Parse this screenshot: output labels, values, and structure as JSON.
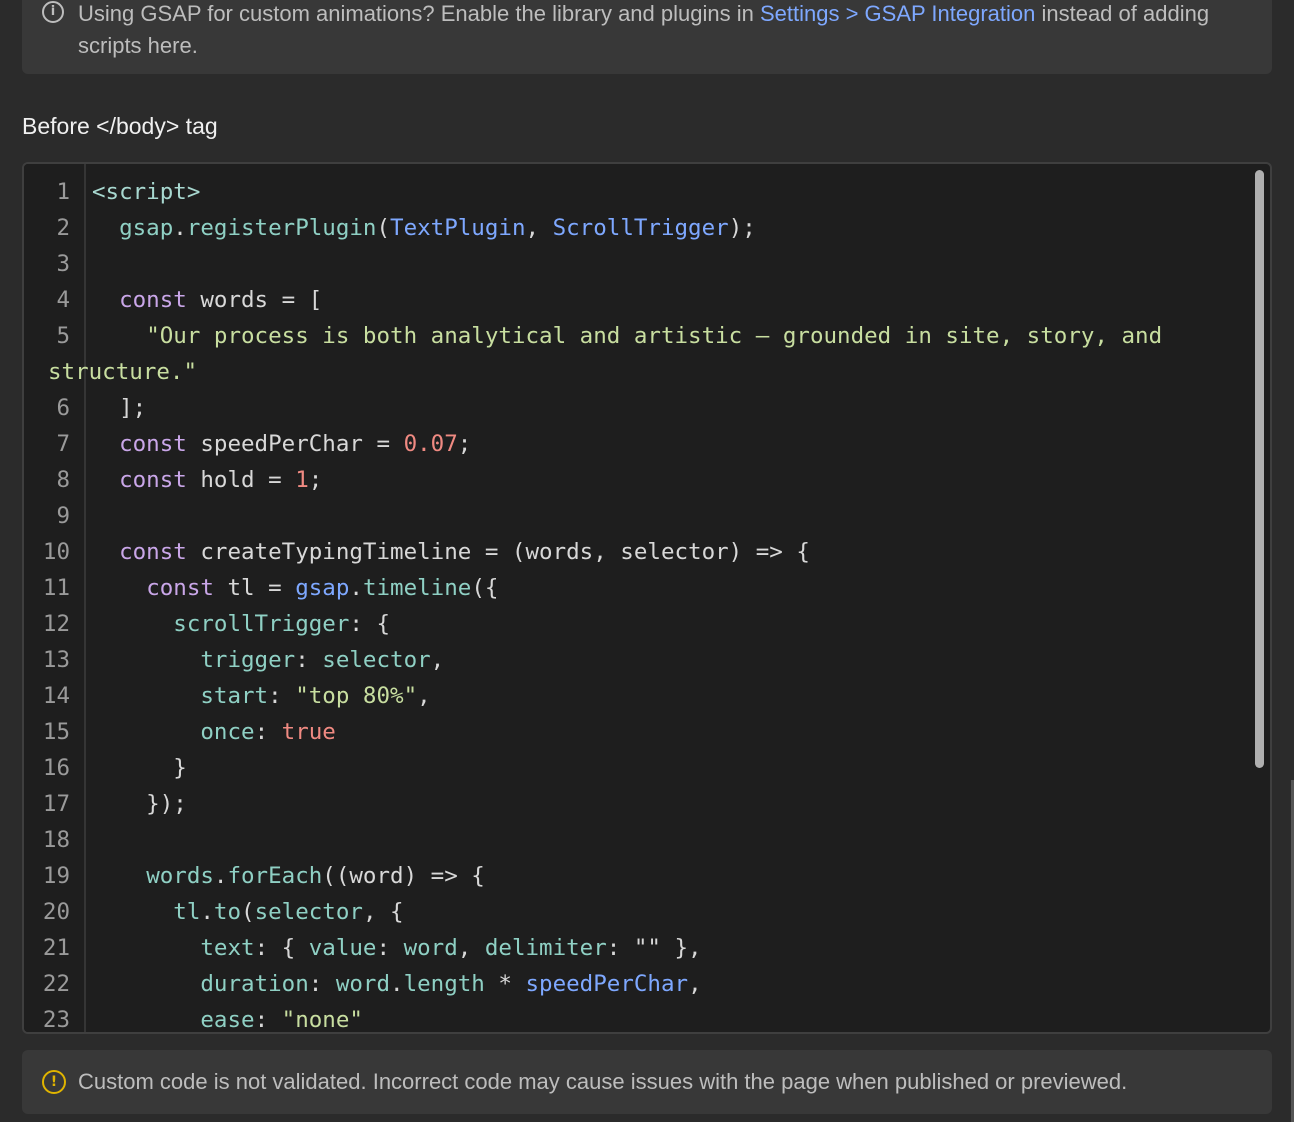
{
  "top_notice": {
    "icon": "info-icon",
    "icon_glyph": "i",
    "text_before": "Using GSAP for custom animations? Enable the library and plugins in ",
    "link_text": "Settings > GSAP Integration",
    "text_after": " instead of adding scripts here."
  },
  "section": {
    "label": "Before </body> tag"
  },
  "editor": {
    "lines": [
      {
        "n": "1"
      },
      {
        "n": "2"
      },
      {
        "n": "3"
      },
      {
        "n": "4"
      },
      {
        "n": "5"
      },
      {
        "n": ""
      },
      {
        "n": "6"
      },
      {
        "n": "7"
      },
      {
        "n": "8"
      },
      {
        "n": "9"
      },
      {
        "n": "10"
      },
      {
        "n": "11"
      },
      {
        "n": "12"
      },
      {
        "n": "13"
      },
      {
        "n": "14"
      },
      {
        "n": "15"
      },
      {
        "n": "16"
      },
      {
        "n": "17"
      },
      {
        "n": "18"
      },
      {
        "n": "19"
      },
      {
        "n": "20"
      },
      {
        "n": "21"
      },
      {
        "n": "22"
      },
      {
        "n": "23"
      }
    ],
    "code": {
      "l1_tag": "<script>",
      "l2_indent": "  ",
      "l2_obj": "gsap",
      "l2_dot": ".",
      "l2_fn": "registerPlugin",
      "l2_open": "(",
      "l2_cls1": "TextPlugin",
      "l2_comma": ", ",
      "l2_cls2": "ScrollTrigger",
      "l2_close": ");",
      "l4_indent": "  ",
      "l4_kw": "const",
      "l4_rest": " words = [",
      "l5_indent": "    ",
      "l5_str": "\"Our process is both analytical and artistic — grounded in site, story, and",
      "l5b_str": "structure.\"",
      "l6_text": "  ];",
      "l7_indent": "  ",
      "l7_kw": "const",
      "l7_mid": " speedPerChar = ",
      "l7_num": "0.07",
      "l7_end": ";",
      "l8_indent": "  ",
      "l8_kw": "const",
      "l8_mid": " hold = ",
      "l8_num": "1",
      "l8_end": ";",
      "l10_indent": "  ",
      "l10_kw": "const",
      "l10_rest": " createTypingTimeline = (words, selector) => {",
      "l11_indent": "    ",
      "l11_kw": "const",
      "l11_mid": " tl = ",
      "l11_obj": "gsap",
      "l11_dot": ".",
      "l11_fn": "timeline",
      "l11_end": "({",
      "l12_indent": "      ",
      "l12_prop": "scrollTrigger",
      "l12_end": ": {",
      "l13_indent": "        ",
      "l13_prop": "trigger",
      "l13_colon": ": ",
      "l13_val": "selector",
      "l13_end": ",",
      "l14_indent": "        ",
      "l14_prop": "start",
      "l14_colon": ": ",
      "l14_str": "\"top 80%\"",
      "l14_end": ",",
      "l15_indent": "        ",
      "l15_prop": "once",
      "l15_colon": ": ",
      "l15_bool": "true",
      "l16_text": "      }",
      "l17_text": "    });",
      "l19_indent": "    ",
      "l19_obj": "words",
      "l19_dot": ".",
      "l19_fn": "forEach",
      "l19_rest": "((word) => {",
      "l20_indent": "      ",
      "l20_obj": "tl",
      "l20_dot": ".",
      "l20_fn": "to",
      "l20_open": "(",
      "l20_val": "selector",
      "l20_end": ", {",
      "l21_indent": "        ",
      "l21_prop": "text",
      "l21_a": ": { ",
      "l21_prop2": "value",
      "l21_b": ": ",
      "l21_val": "word",
      "l21_c": ", ",
      "l21_prop3": "delimiter",
      "l21_d": ": ",
      "l21_str": "\"\"",
      "l21_end": " },",
      "l22_indent": "        ",
      "l22_prop": "duration",
      "l22_a": ": ",
      "l22_obj": "word",
      "l22_dot": ".",
      "l22_prop2": "length",
      "l22_op": " * ",
      "l22_cls": "speedPerChar",
      "l22_end": ",",
      "l23_indent": "        ",
      "l23_prop": "ease",
      "l23_a": ": ",
      "l23_str": "\"none\""
    }
  },
  "bottom_notice": {
    "icon": "warning-icon",
    "icon_glyph": "!",
    "text": "Custom code is not validated. Incorrect code may cause issues with the page when published or previewed."
  },
  "colors": {
    "background": "#2b2b2b",
    "editor_background": "#1e1e1e",
    "link": "#7ea8ff",
    "warning": "#e0b400",
    "keyword": "#c9a6e8",
    "string": "#c8dea0",
    "number": "#f08a82"
  }
}
